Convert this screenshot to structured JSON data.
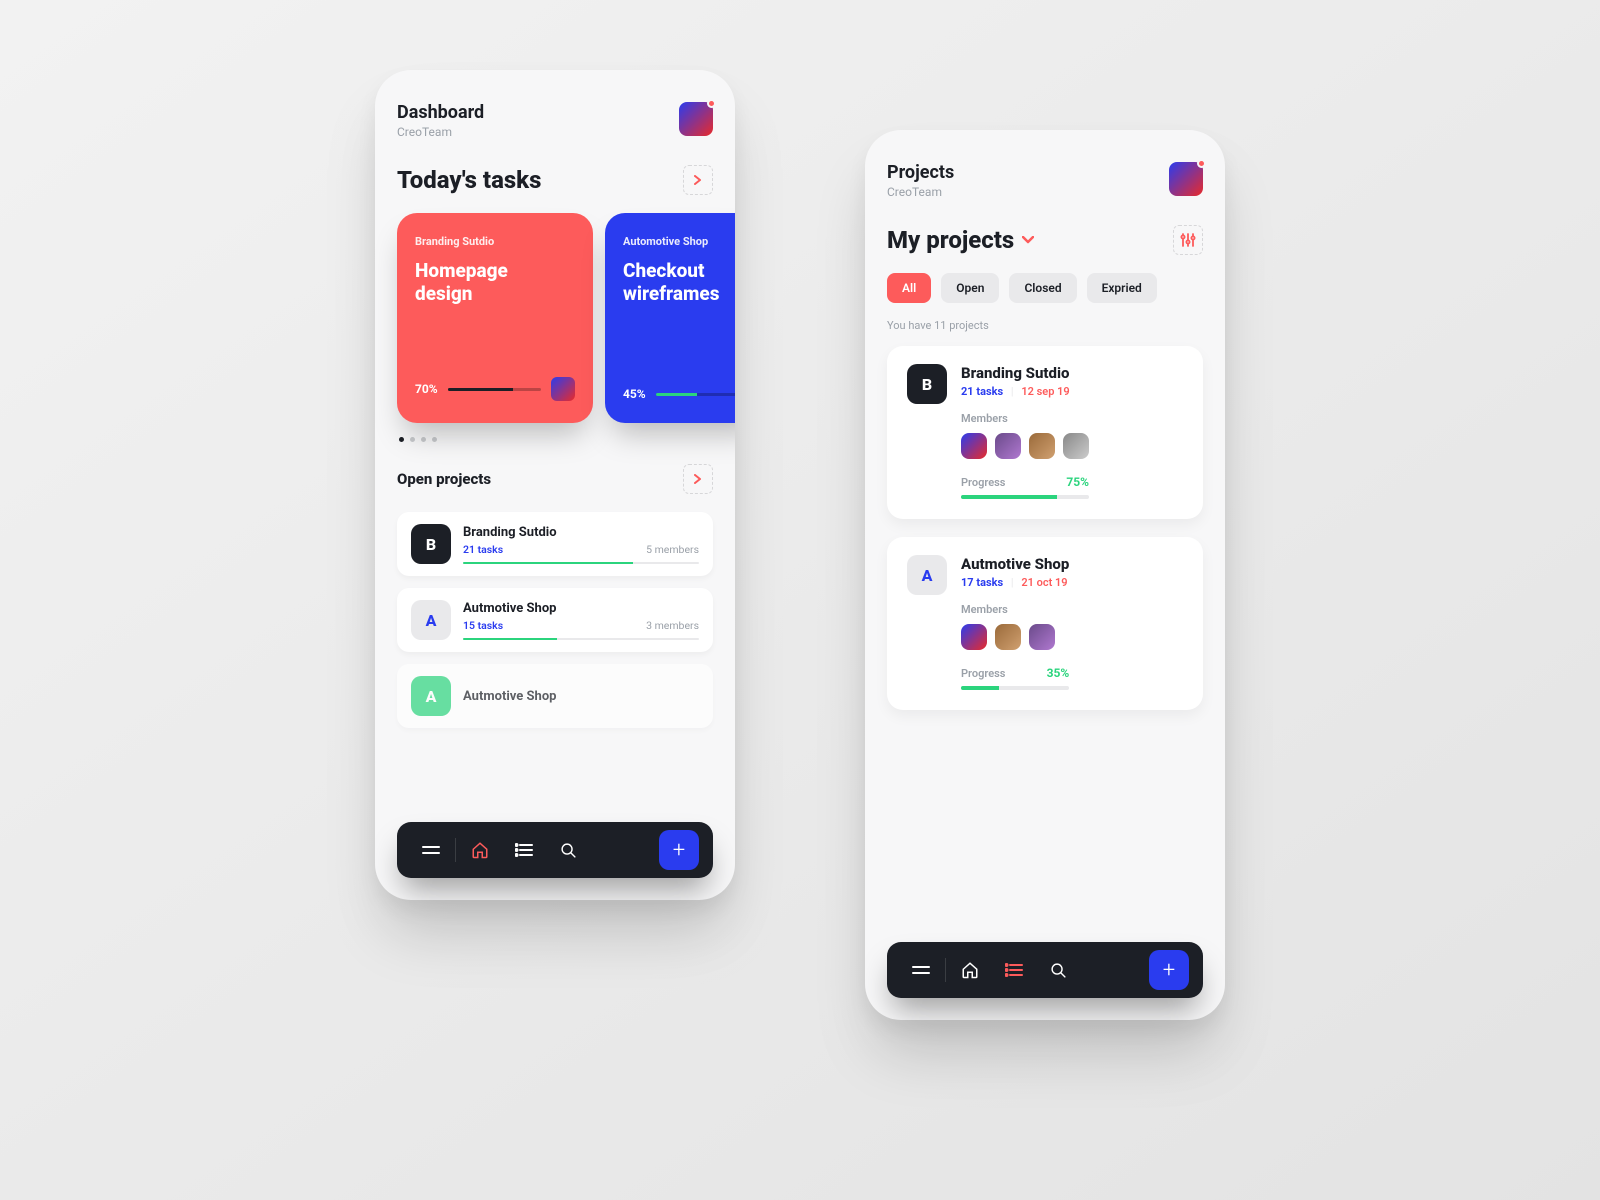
{
  "left": {
    "header": {
      "title": "Dashboard",
      "subtitle": "CreoTeam"
    },
    "section_tasks": "Today's tasks",
    "task_cards": [
      {
        "project": "Branding Sutdio",
        "name": "Homepage design",
        "pct": "70%",
        "pct_w": 70
      },
      {
        "project": "Automotive Shop",
        "name": "Checkout wireframes",
        "pct": "45%",
        "pct_w": 45
      }
    ],
    "section_open": "Open projects",
    "open_items": [
      {
        "letter": "B",
        "cls": "dark",
        "title": "Branding Sutdio",
        "tasks": "21 tasks",
        "members": "5 members",
        "pct_w": 72
      },
      {
        "letter": "A",
        "cls": "light",
        "title": "Autmotive Shop",
        "tasks": "15 tasks",
        "members": "3 members",
        "pct_w": 40
      },
      {
        "letter": "A",
        "cls": "green",
        "title": "Autmotive Shop",
        "tasks": "",
        "members": "",
        "pct_w": 0
      }
    ],
    "nav_active": "home"
  },
  "right": {
    "header": {
      "title": "Projects",
      "subtitle": "CreoTeam"
    },
    "section": "My projects",
    "tabs": [
      "All",
      "Open",
      "Closed",
      "Expried"
    ],
    "active_tab": "All",
    "hint": "You have 11 projects",
    "projects": [
      {
        "letter": "B",
        "cls": "dark",
        "name": "Branding Sutdio",
        "tasks": "21 tasks",
        "date": "12 sep 19",
        "members_label": "Members",
        "progress_label": "Progress",
        "pct": "75%",
        "pct_w": 75,
        "avas": 4
      },
      {
        "letter": "A",
        "cls": "light",
        "name": "Autmotive Shop",
        "tasks": "17 tasks",
        "date": "21 oct 19",
        "members_label": "Members",
        "progress_label": "Progress",
        "pct": "35%",
        "pct_w": 35,
        "avas": 3
      }
    ],
    "nav_active": "list"
  }
}
